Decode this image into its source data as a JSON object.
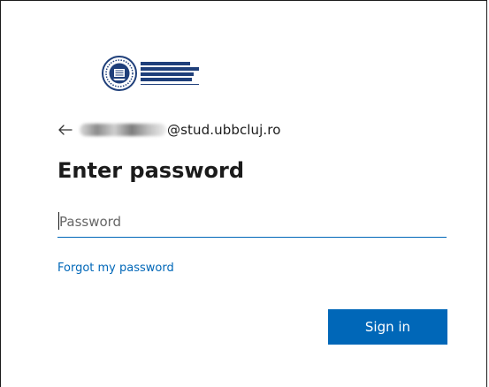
{
  "logo": {
    "icon": "university-seal-icon",
    "lines": [
      "UNIVERSITATEA BABEȘ-BOLYAI",
      "BABEȘ-BOLYAI TUDOMÁNYEGYETEM",
      "BABEȘ-BOLYAI UNIVERSITÄT",
      "BABEȘ-BOLYAI UNIVERSITY"
    ],
    "color": "#1f3f7a"
  },
  "identity": {
    "back_icon": "back-arrow-icon",
    "email_domain": "@stud.ubbcluj.ro"
  },
  "title": "Enter password",
  "password": {
    "placeholder": "Password",
    "value": ""
  },
  "forgot_link": "Forgot my password",
  "signin_button": "Sign in",
  "colors": {
    "accent": "#0067b8",
    "text": "#1b1b1b",
    "background": "#ffffff"
  }
}
